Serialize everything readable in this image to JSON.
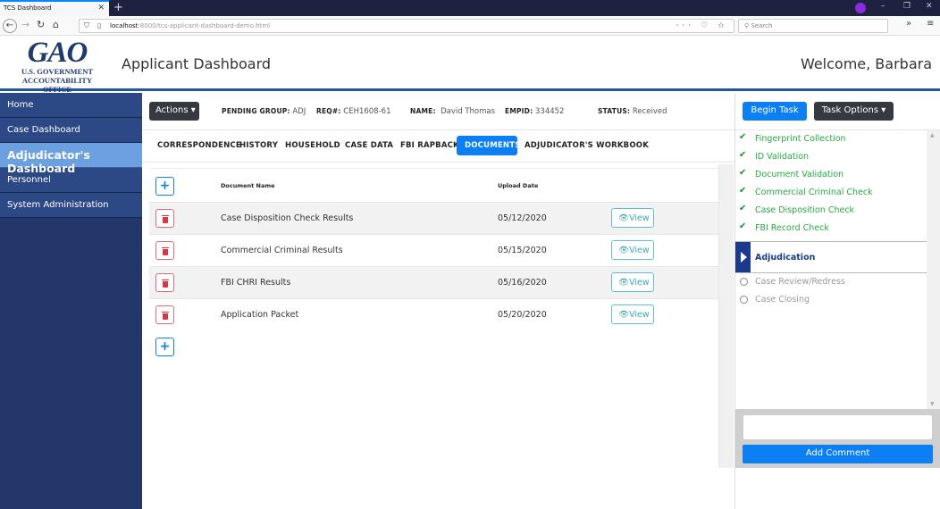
{
  "browser": {
    "tab_title": "TCS Dashboard",
    "url_host": "localhost",
    "url_path": ":8000/tcs-applicant-dashboard-demo.html",
    "search_placeholder": "Search"
  },
  "header": {
    "logo_big": "GAO",
    "logo_line1": "U.S. GOVERNMENT",
    "logo_line2": "ACCOUNTABILITY OFFICE",
    "title": "Applicant Dashboard",
    "welcome": "Welcome, Barbara"
  },
  "sidebar": {
    "items": [
      {
        "label": "Home"
      },
      {
        "label": "Case Dashboard"
      },
      {
        "label": "Adjudicator's Dashboard",
        "active": true
      },
      {
        "label": "Personnel"
      },
      {
        "label": "System Administration"
      }
    ]
  },
  "infobar": {
    "actions_label": "Actions ▾",
    "pending_group_label": "Pending Group:",
    "pending_group_value": "ADJ",
    "req_label": "Req#:",
    "req_value": "CEH1608-61",
    "name_label": "Name:",
    "name_value": "David Thomas",
    "empid_label": "EMPID:",
    "empid_value": "334452",
    "status_label": "Status:",
    "status_value": "Received"
  },
  "tabs": [
    {
      "label": "Correspondence"
    },
    {
      "label": "History"
    },
    {
      "label": "Household"
    },
    {
      "label": "Case Data"
    },
    {
      "label": "FBI Rapback"
    },
    {
      "label": "Documents",
      "active": true
    },
    {
      "label": "Adjudicator's Workbook"
    }
  ],
  "documents": {
    "col_name": "Document Name",
    "col_date": "Upload Date",
    "view_label": "View",
    "rows": [
      {
        "name": "Case Disposition Check Results",
        "date": "05/12/2020"
      },
      {
        "name": "Commercial Criminal Results",
        "date": "05/15/2020"
      },
      {
        "name": "FBI CHRI Results",
        "date": "05/16/2020"
      },
      {
        "name": "Application Packet",
        "date": "05/20/2020"
      }
    ]
  },
  "task_panel": {
    "begin_label": "Begin Task",
    "options_label": "Task Options ▾",
    "steps": [
      {
        "label": "Fingerprint Collection",
        "state": "done"
      },
      {
        "label": "ID Validation",
        "state": "done"
      },
      {
        "label": "Document Validation",
        "state": "done"
      },
      {
        "label": "Commercial Criminal Check",
        "state": "done"
      },
      {
        "label": "Case Disposition Check",
        "state": "done"
      },
      {
        "label": "FBI Record Check",
        "state": "done"
      },
      {
        "label": "Adjudication",
        "state": "current"
      },
      {
        "label": "Case Review/Redress",
        "state": "pending"
      },
      {
        "label": "Case Closing",
        "state": "pending"
      }
    ],
    "comment_value": "",
    "add_comment_label": "Add Comment"
  },
  "colors": {
    "primary": "#0d7ff5",
    "dark": "#343a40",
    "sidebar": "#2c4885",
    "sidebar_active": "#6da0e0",
    "success": "#28a745",
    "danger": "#dc3545",
    "info": "#39a8b8",
    "current_step": "#1a3a8f"
  }
}
